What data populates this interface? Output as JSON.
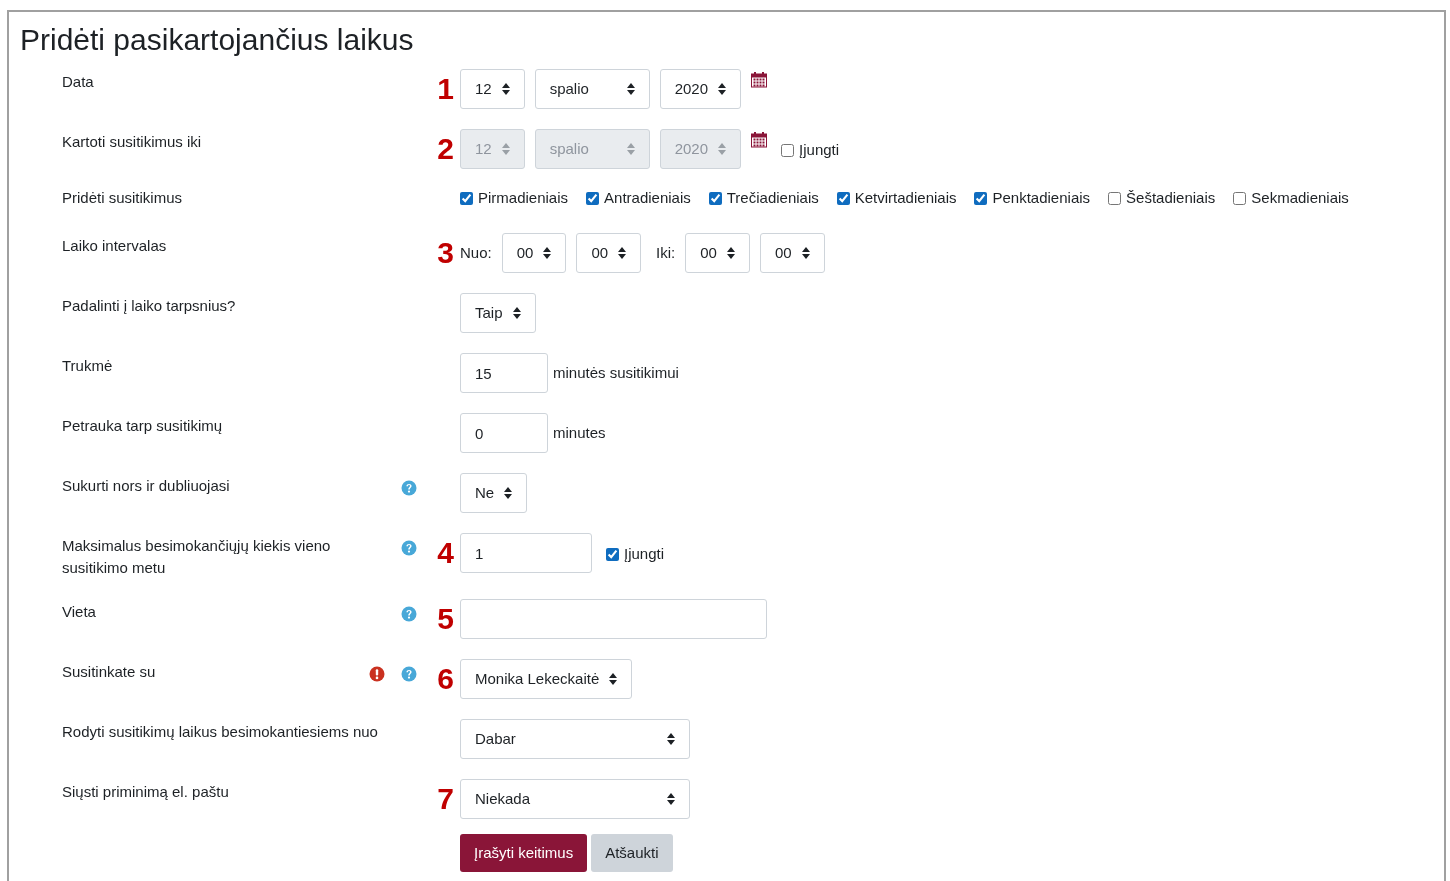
{
  "form": {
    "title": "Pridėti pasikartojančius laikus",
    "rows": [
      {
        "label": "Data",
        "marker": "1",
        "controls": [
          {
            "kind": "select",
            "value": "12",
            "disabled": false
          },
          {
            "kind": "month_select",
            "value": "spalio",
            "disabled": false
          },
          {
            "kind": "select",
            "value": "2020",
            "disabled": false
          },
          {
            "kind": "calendar"
          }
        ]
      },
      {
        "label": "Kartoti susitikimus iki",
        "marker": "2",
        "controls": [
          {
            "kind": "select",
            "value": "12",
            "disabled": true
          },
          {
            "kind": "month_select",
            "value": "spalio",
            "disabled": true
          },
          {
            "kind": "select",
            "value": "2020",
            "disabled": true
          },
          {
            "kind": "calendar"
          },
          {
            "kind": "checkbox",
            "label": "Įjungti",
            "checked": false
          }
        ]
      },
      {
        "label": "Pridėti susitikimus",
        "kind": "checks",
        "controls": [
          {
            "kind": "checkbox",
            "label": "Pirmadieniais",
            "checked": true
          },
          {
            "kind": "checkbox",
            "label": "Antradieniais",
            "checked": true
          },
          {
            "kind": "checkbox",
            "label": "Trečiadieniais",
            "checked": true
          },
          {
            "kind": "checkbox",
            "label": "Ketvirtadieniais",
            "checked": true
          },
          {
            "kind": "checkbox",
            "label": "Penktadieniais",
            "checked": true
          },
          {
            "kind": "checkbox",
            "label": "Šeštadieniais",
            "checked": false
          },
          {
            "kind": "checkbox",
            "label": "Sekmadieniais",
            "checked": false
          }
        ]
      },
      {
        "label": "Laiko intervalas",
        "marker": "3",
        "controls": [
          {
            "kind": "text",
            "text": "Nuo:"
          },
          {
            "kind": "select",
            "value": "00",
            "disabled": false
          },
          {
            "kind": "select",
            "value": "00",
            "disabled": false
          },
          {
            "kind": "text",
            "text": "Iki:"
          },
          {
            "kind": "select",
            "value": "00",
            "disabled": false
          },
          {
            "kind": "select",
            "value": "00",
            "disabled": false
          }
        ]
      },
      {
        "label": "Padalinti į laiko tarpsnius?",
        "controls": [
          {
            "kind": "select",
            "value": "Taip",
            "disabled": false
          }
        ]
      },
      {
        "label": "Trukmė",
        "controls": [
          {
            "kind": "number_input",
            "value": "15"
          },
          {
            "kind": "text",
            "text": "minutės susitikimui"
          }
        ]
      },
      {
        "label": "Petrauka tarp susitikimų",
        "controls": [
          {
            "kind": "number_input",
            "value": "0"
          },
          {
            "kind": "text",
            "text": "minutes"
          }
        ]
      },
      {
        "label": "Sukurti nors ir dubliuojasi",
        "icons": [
          {
            "kind": "help"
          }
        ],
        "controls": [
          {
            "kind": "select",
            "value": "Ne",
            "disabled": false
          }
        ]
      },
      {
        "label": "Maksimalus besimokančiųjų kiekis vieno susitikimo metu",
        "icons": [
          {
            "kind": "help"
          }
        ],
        "marker": "4",
        "controls": [
          {
            "kind": "short_input",
            "value": "1"
          },
          {
            "kind": "checkbox",
            "label": "Įjungti",
            "checked": true
          }
        ]
      },
      {
        "label": "Vieta",
        "icons": [
          {
            "kind": "help"
          }
        ],
        "marker": "5",
        "controls": [
          {
            "kind": "text_input"
          }
        ]
      },
      {
        "label": "Susitinkate su",
        "icons": [
          {
            "kind": "error"
          },
          {
            "kind": "help"
          }
        ],
        "marker": "6",
        "controls": [
          {
            "kind": "select",
            "value": "Monika Lekeckaitė",
            "disabled": false
          }
        ]
      },
      {
        "label": "Rodyti susitikimų laikus besimokantiesiems nuo",
        "controls": [
          {
            "kind": "wide_select",
            "value": "Dabar",
            "disabled": false
          }
        ]
      },
      {
        "label": "Siųsti priminimą el. paštu",
        "marker": "7",
        "controls": [
          {
            "kind": "wide_select",
            "value": "Niekada",
            "disabled": false
          }
        ]
      }
    ],
    "buttons": [
      {
        "label": "Įrašyti keitimus",
        "kind": "primary"
      },
      {
        "label": "Atšaukti",
        "kind": "secondary"
      }
    ]
  }
}
